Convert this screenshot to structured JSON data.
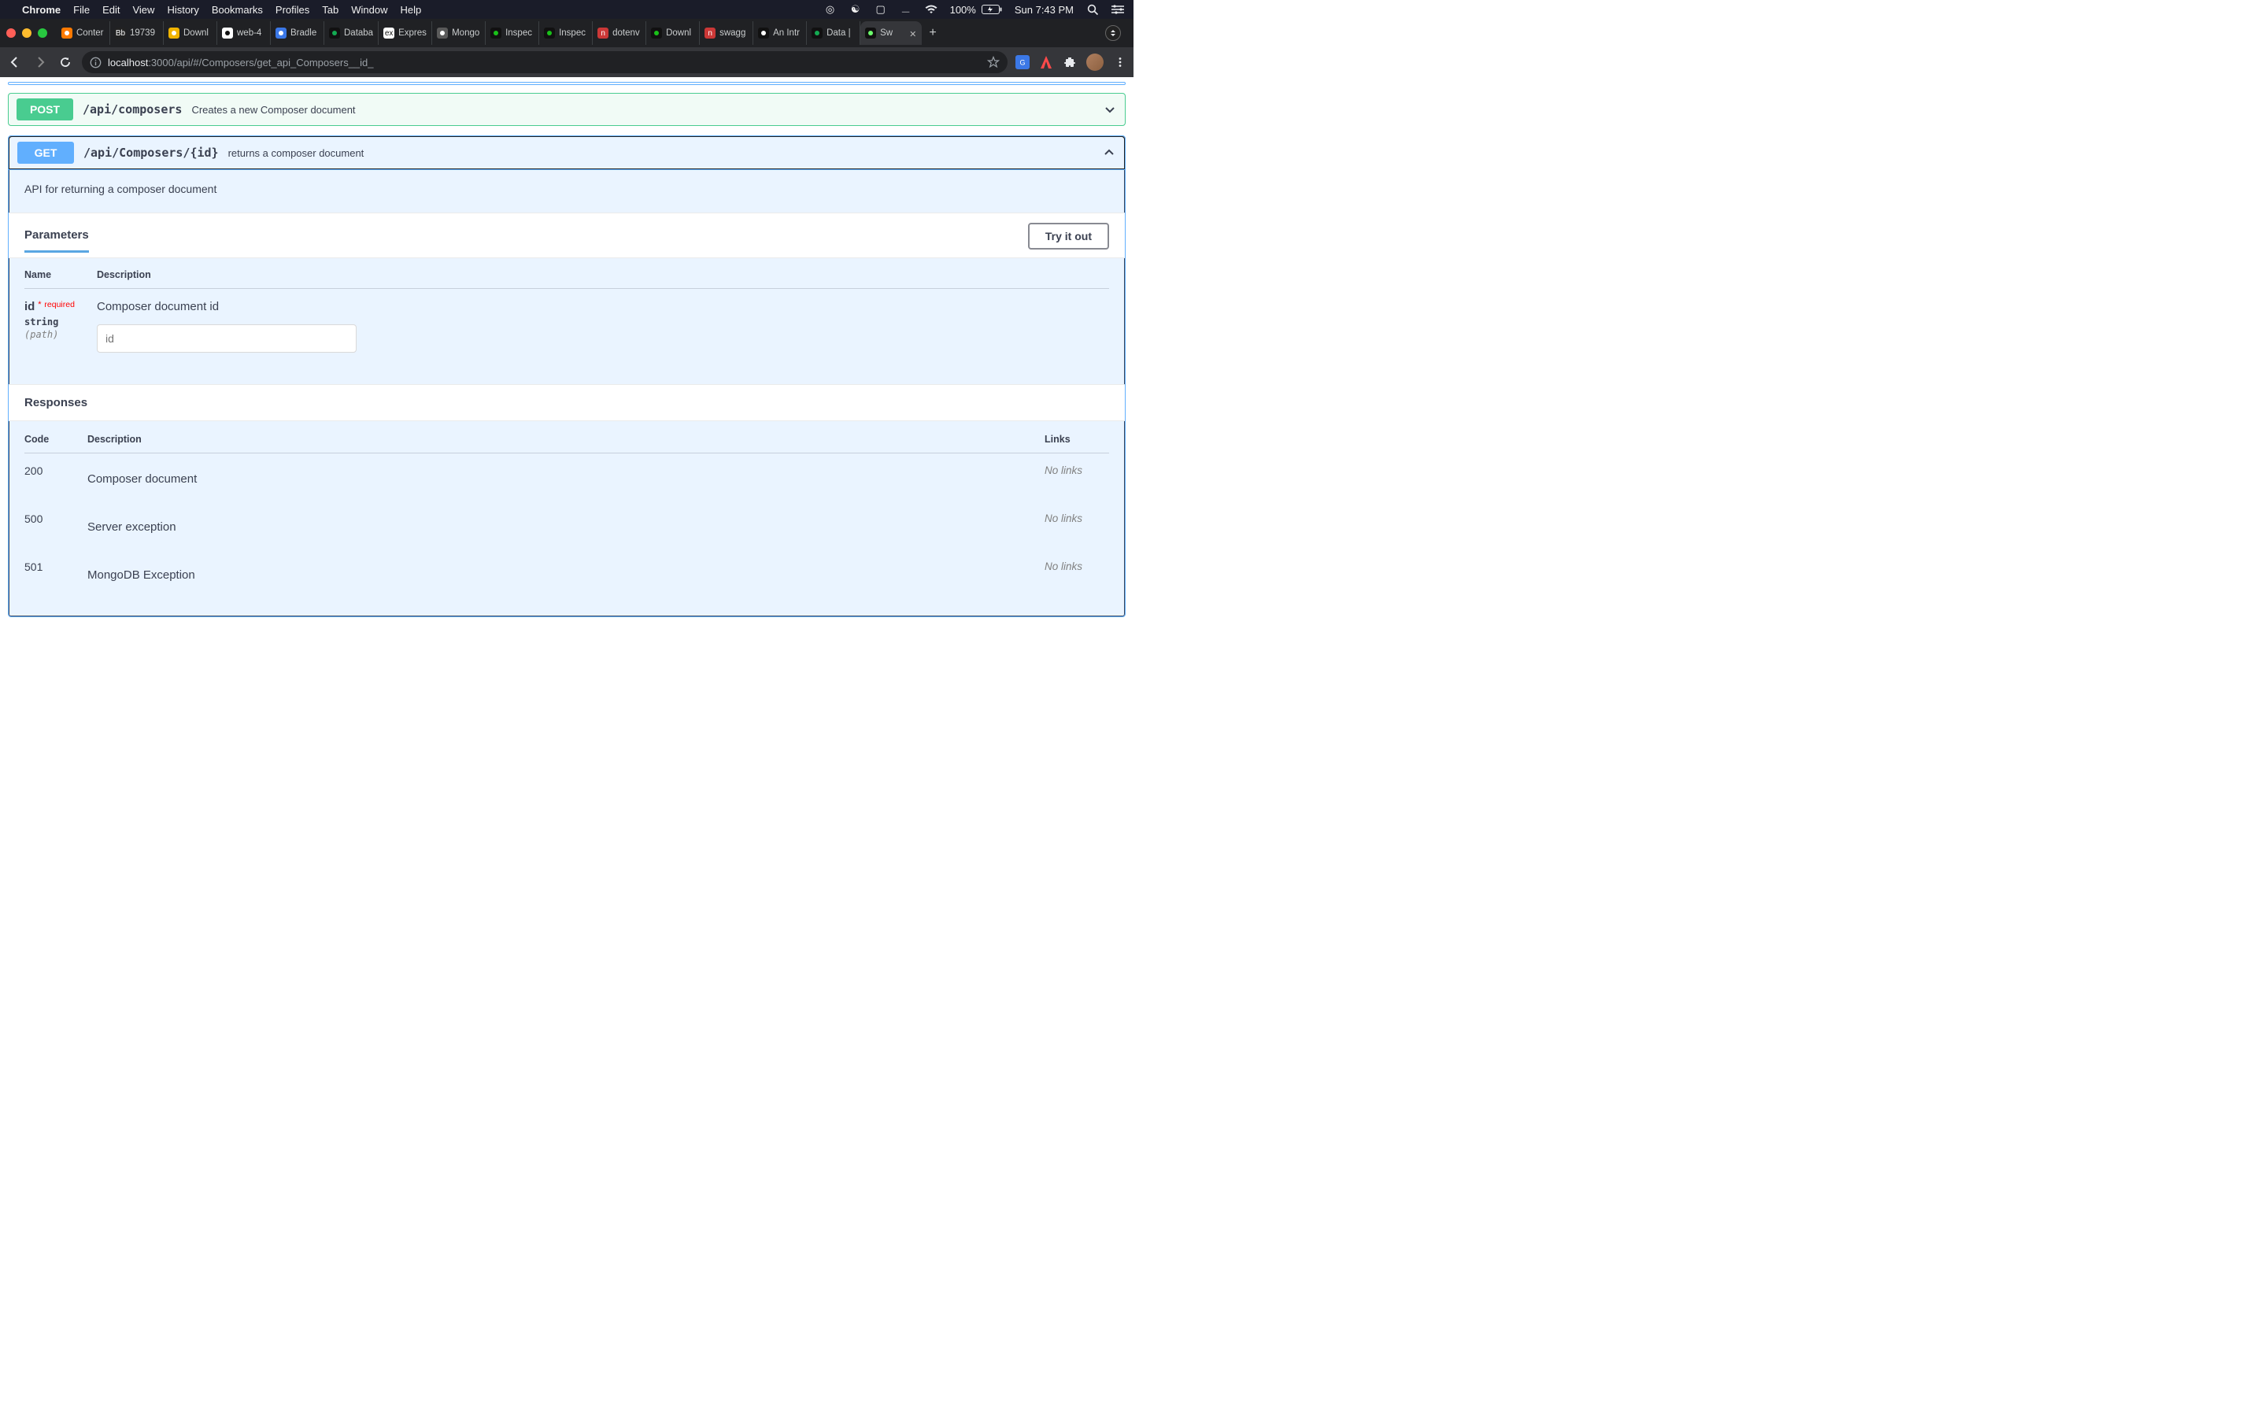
{
  "mac_menu": {
    "app": "Chrome",
    "items": [
      "File",
      "Edit",
      "View",
      "History",
      "Bookmarks",
      "Profiles",
      "Tab",
      "Window",
      "Help"
    ],
    "right": {
      "battery": "100%",
      "clock": "Sun 7:43 PM"
    }
  },
  "tabs": [
    {
      "label": "Conter",
      "fav_bg": "#ff7a00"
    },
    {
      "label": "19739",
      "fav_text": "Bb",
      "fav_bg": "#222"
    },
    {
      "label": "Downl",
      "fav_bg": "#f0b400"
    },
    {
      "label": "web-4",
      "fav_bg": "#ffffff",
      "fav_fg": "#111"
    },
    {
      "label": "Bradle",
      "fav_bg": "#3b78e7"
    },
    {
      "label": "Databa",
      "fav_bg": "#111",
      "fav_fg": "#13aa52"
    },
    {
      "label": "Expres",
      "fav_bg": "#ffffff",
      "fav_text": "ex",
      "fav_fg": "#111"
    },
    {
      "label": "Mongo",
      "fav_bg": "#5a5a5a"
    },
    {
      "label": "Inspec",
      "fav_bg": "#111",
      "fav_fg": "#19c119"
    },
    {
      "label": "Inspec",
      "fav_bg": "#111",
      "fav_fg": "#19c119"
    },
    {
      "label": "dotenv",
      "fav_bg": "#cb3837",
      "fav_text": "n"
    },
    {
      "label": "Downl",
      "fav_bg": "#111",
      "fav_fg": "#19c119"
    },
    {
      "label": "swagg",
      "fav_bg": "#cb3837",
      "fav_text": "n"
    },
    {
      "label": "An Intr",
      "fav_bg": "#111"
    },
    {
      "label": "Data |",
      "fav_bg": "#111",
      "fav_fg": "#13aa52"
    },
    {
      "label": "Sw",
      "fav_bg": "#111",
      "fav_fg": "#6cff6c",
      "active": true
    }
  ],
  "addr": {
    "host": "localhost",
    "port": ":3000",
    "path": "/api/#/Composers/get_api_Composers__id_"
  },
  "op_post": {
    "method": "POST",
    "path": "/api/composers",
    "summary": "Creates a new Composer document"
  },
  "op_get": {
    "method": "GET",
    "path": "/api/Composers/{id}",
    "summary": "returns a composer document",
    "long": "API for returning a composer document",
    "params_title": "Parameters",
    "tryout": "Try it out",
    "param_head_name": "Name",
    "param_head_desc": "Description",
    "param": {
      "name": "id",
      "required_label": "required",
      "type": "string",
      "in": "(path)",
      "desc": "Composer document id",
      "placeholder": "id"
    },
    "responses_title": "Responses",
    "resp_head_code": "Code",
    "resp_head_desc": "Description",
    "resp_head_links": "Links",
    "responses": [
      {
        "code": "200",
        "desc": "Composer document",
        "links": "No links"
      },
      {
        "code": "500",
        "desc": "Server exception",
        "links": "No links"
      },
      {
        "code": "501",
        "desc": "MongoDB Exception",
        "links": "No links"
      }
    ]
  }
}
